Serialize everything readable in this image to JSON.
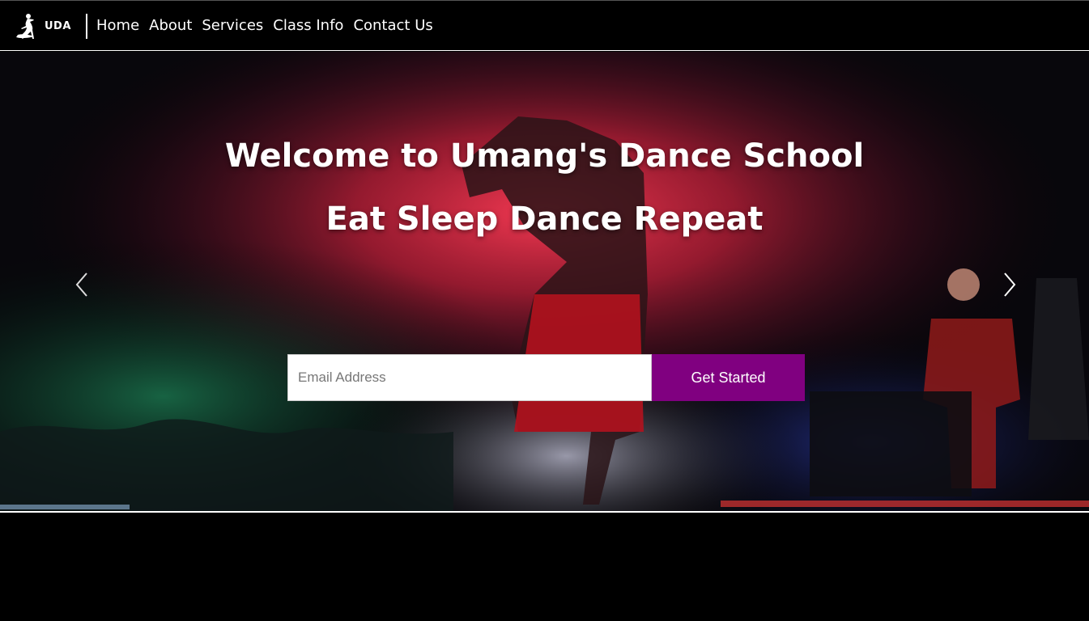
{
  "nav": {
    "logo_icon": "dancer-silhouette-icon",
    "brand": "UDA",
    "links": [
      "Home",
      "About",
      "Services",
      "Class Info",
      "Contact Us"
    ]
  },
  "hero": {
    "title": "Welcome to Umang's Dance School",
    "subtitle": "Eat Sleep Dance Repeat",
    "prev_icon": "chevron-left-icon",
    "next_icon": "chevron-right-icon",
    "email_placeholder": "Email Address",
    "cta_label": "Get Started"
  },
  "colors": {
    "accent": "#800080",
    "nav_bg": "#000000",
    "text": "#ffffff"
  }
}
